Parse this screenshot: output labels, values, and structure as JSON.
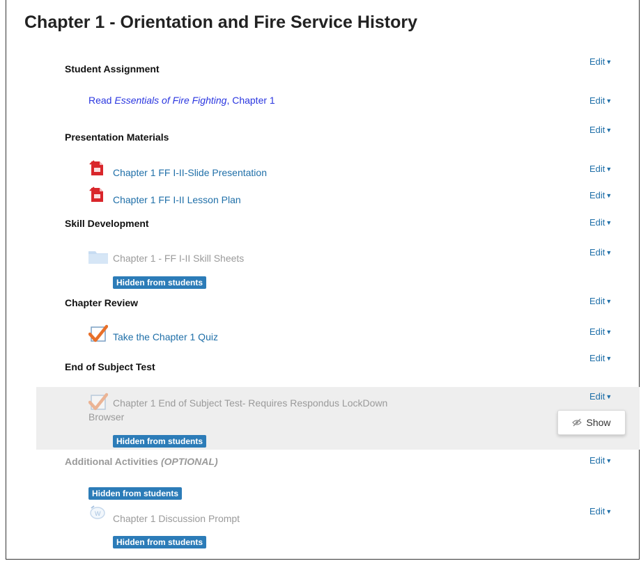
{
  "page_title": "Chapter 1 - Orientation and Fire Service History",
  "edit_label": "Edit",
  "sections": [
    {
      "label": "Student Assignment"
    },
    {
      "label": "Presentation Materials"
    },
    {
      "label": "Skill Development"
    },
    {
      "label": "Chapter Review"
    },
    {
      "label": "End of Subject Test"
    },
    {
      "label": "Additional Activities",
      "label_suffix": "(OPTIONAL)"
    }
  ],
  "activities": {
    "reading": {
      "prefix": "Read ",
      "title": "Essentials of Fire Fighting",
      "suffix": ", Chapter 1"
    },
    "slides": {
      "label": "Chapter 1 FF I-II-Slide Presentation",
      "icon": "pdf-icon"
    },
    "lesson_plan": {
      "label": "Chapter 1 FF I-II Lesson Plan",
      "icon": "pdf-icon"
    },
    "skill_sheets": {
      "label": "Chapter 1 - FF I-II Skill Sheets",
      "icon": "folder-icon"
    },
    "quiz": {
      "label": "Take the Chapter 1 Quiz",
      "icon": "quiz-icon"
    },
    "test_line1": {
      "label": "Chapter 1 End of Subject Test- Requires Respondus LockDown",
      "icon": "quiz-icon"
    },
    "test_line2": {
      "label": "Browser"
    },
    "discussion": {
      "label": "Chapter 1 Discussion Prompt",
      "icon": "forum-icon"
    }
  },
  "badges": {
    "hidden": "Hidden from students"
  },
  "menu": {
    "show_label": "Show"
  },
  "colors": {
    "link": "#1f6fa8",
    "badge": "#2c7cb8",
    "pdf": "#d9262b",
    "check": "#e8702a"
  }
}
